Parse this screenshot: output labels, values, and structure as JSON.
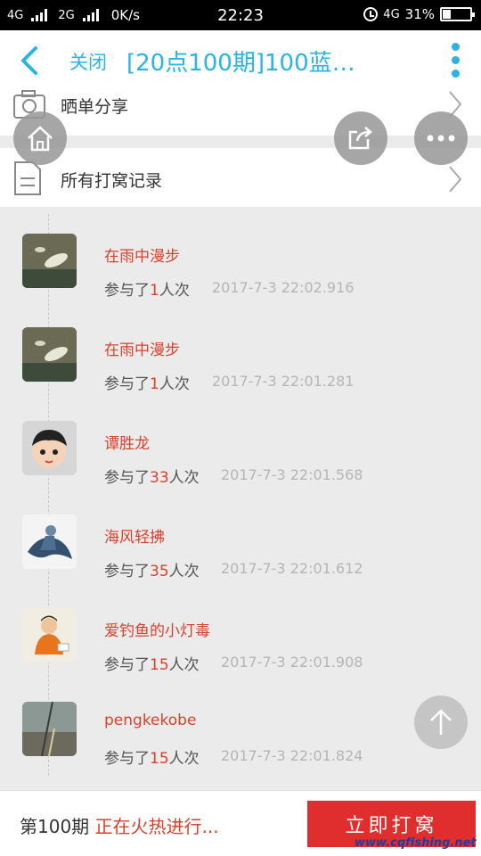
{
  "status_bar": {
    "net1": "4G",
    "net2": "2G",
    "speed": "0K/s",
    "time": "22:23",
    "net3": "4G",
    "battery": "31%",
    "battery_level": 0.31
  },
  "header": {
    "close_label": "关闭",
    "title": "[20点100期]100蓝…"
  },
  "menu": {
    "share_label": "晒单分享",
    "records_label": "所有打窝记录"
  },
  "records": [
    {
      "name": "在雨中漫步",
      "joined_prefix": "参与了",
      "count": "1",
      "joined_suffix": "人次",
      "time": "2017-7-3 22:02.916"
    },
    {
      "name": "在雨中漫步",
      "joined_prefix": "参与了",
      "count": "1",
      "joined_suffix": "人次",
      "time": "2017-7-3 22:01.281"
    },
    {
      "name": "谭胜龙",
      "joined_prefix": "参与了",
      "count": "33",
      "joined_suffix": "人次",
      "time": "2017-7-3 22:01.568"
    },
    {
      "name": "海风轻拂",
      "joined_prefix": "参与了",
      "count": "35",
      "joined_suffix": "人次",
      "time": "2017-7-3 22:01.612"
    },
    {
      "name": "爱钓鱼的小灯毒",
      "joined_prefix": "参与了",
      "count": "15",
      "joined_suffix": "人次",
      "time": "2017-7-3 22:01.908"
    },
    {
      "name": "pengkekobe",
      "joined_prefix": "参与了",
      "count": "15",
      "joined_suffix": "人次",
      "time": "2017-7-3 22:01.824"
    }
  ],
  "bottom": {
    "period": "第100期",
    "status": "正在火热进行...",
    "button_label": "立即打窝",
    "watermark": "www.cqfishing.net"
  },
  "colors": {
    "accent": "#2bb3e6",
    "highlight": "#d9412b",
    "button": "#e02d2d"
  },
  "icons": [
    "back-arrow-icon",
    "more-dots-icon",
    "camera-icon",
    "document-icon",
    "chevron-right-icon",
    "home-icon",
    "share-icon",
    "ellipsis-icon",
    "arrow-up-icon"
  ]
}
